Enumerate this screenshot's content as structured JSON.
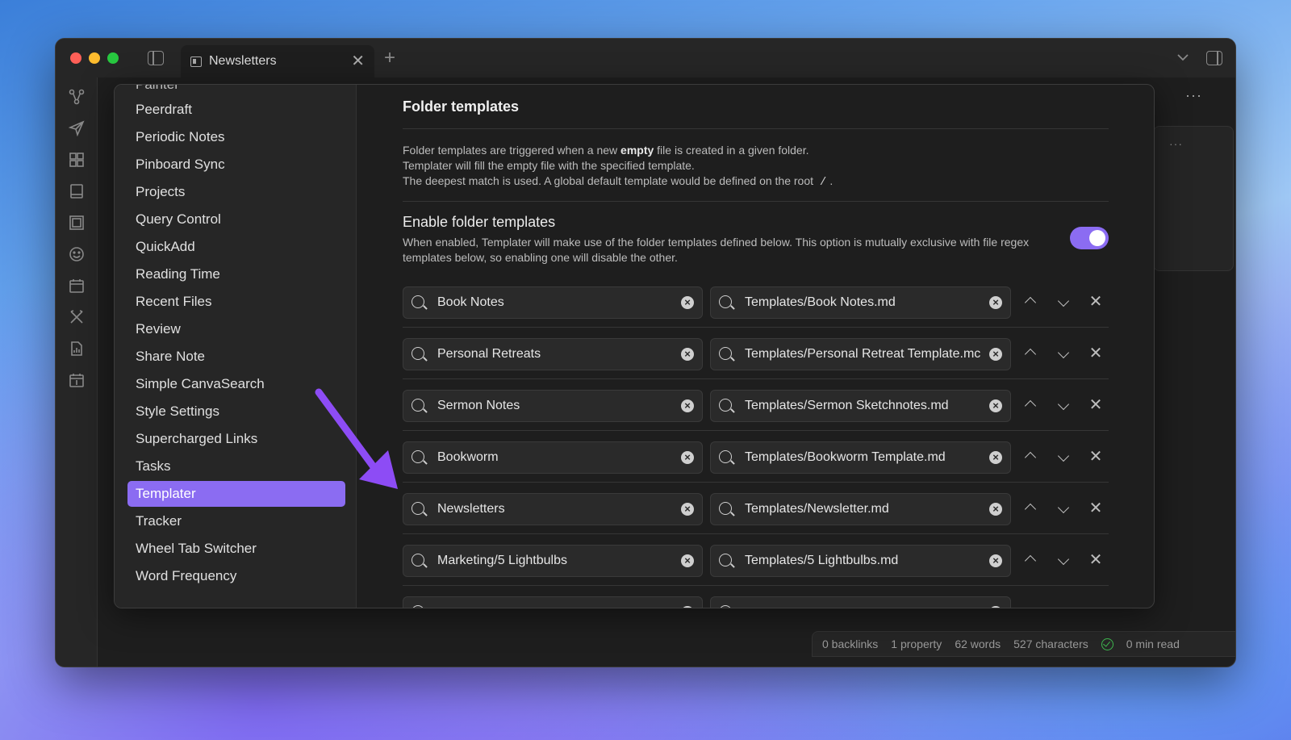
{
  "window": {
    "tab_title": "Newsletters",
    "tab_close": "✕",
    "new_tab": "+",
    "chevron": "⌄",
    "dots": "···"
  },
  "ribbon_icons": [
    "graph-icon",
    "send-icon",
    "layout-icon",
    "book-icon",
    "slides-icon",
    "smiley-icon",
    "calendar-icon",
    "tools-icon",
    "chart-file-icon",
    "daily-note-icon"
  ],
  "status_bar": {
    "backlinks": "0 backlinks",
    "property": "1 property",
    "words": "62 words",
    "characters": "527 characters",
    "read": "0 min read"
  },
  "settings_sidebar": {
    "items": [
      "Peerdraft",
      "Periodic Notes",
      "Pinboard Sync",
      "Projects",
      "Query Control",
      "QuickAdd",
      "Reading Time",
      "Recent Files",
      "Review",
      "Share Note",
      "Simple CanvaSearch",
      "Style Settings",
      "Supercharged Links",
      "Tasks",
      "Templater",
      "Tracker",
      "Wheel Tab Switcher",
      "Word Frequency"
    ],
    "active": "Templater"
  },
  "folder_templates": {
    "title": "Folder templates",
    "desc_line1_pre": "Folder templates are triggered when a new ",
    "desc_line1_bold": "empty",
    "desc_line1_post": " file is created in a given folder.",
    "desc_line2": "Templater will fill the empty file with the specified template.",
    "desc_line3_pre": "The deepest match is used. A global default template would be defined on the root",
    "desc_line3_code": "/",
    "desc_line3_post": ".",
    "setting_name": "Enable folder templates",
    "setting_desc": "When enabled, Templater will make use of the folder templates defined below. This option is mutually exclusive with file regex templates below, so enabling one will disable the other.",
    "toggle_on": true,
    "rows": [
      {
        "folder": "Book Notes",
        "template": "Templates/Book Notes.md"
      },
      {
        "folder": "Personal Retreats",
        "template": "Templates/Personal Retreat Template.mc"
      },
      {
        "folder": "Sermon Notes",
        "template": "Templates/Sermon Sketchnotes.md"
      },
      {
        "folder": "Bookworm",
        "template": "Templates/Bookworm Template.md"
      },
      {
        "folder": "Newsletters",
        "template": "Templates/Newsletter.md"
      },
      {
        "folder": "Marketing/5 Lightbulbs",
        "template": "Templates/5 Lightbulbs.md"
      }
    ]
  },
  "colors": {
    "accent": "#8b6cf2",
    "arrow": "#8d4cf5",
    "success": "#3fb950"
  }
}
